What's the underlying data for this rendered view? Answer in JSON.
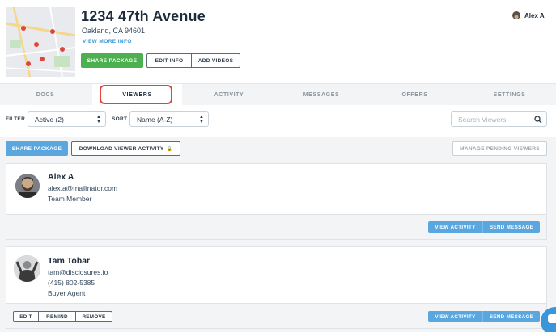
{
  "property": {
    "address": "1234 47th Avenue",
    "city": "Oakland, CA 94601",
    "view_more": "VIEW MORE INFO"
  },
  "header_actions": {
    "share_package": "SHARE PACKAGE",
    "edit_info": "EDIT INFO",
    "add_videos": "ADD VIDEOS"
  },
  "user": {
    "name": "Alex A"
  },
  "tabs": [
    {
      "label": "DOCS"
    },
    {
      "label": "VIEWERS"
    },
    {
      "label": "ACTIVITY"
    },
    {
      "label": "MESSAGES"
    },
    {
      "label": "OFFERS"
    },
    {
      "label": "SETTINGS"
    }
  ],
  "active_tab": "VIEWERS",
  "filters": {
    "filter_label": "FILTER",
    "filter_value": "Active (2)",
    "sort_label": "SORT",
    "sort_value": "Name (A-Z)",
    "search_placeholder": "Search Viewers"
  },
  "toolbar": {
    "share_package": "SHARE PACKAGE",
    "download_activity": "DOWNLOAD VIEWER ACTIVITY",
    "manage_pending": "MANAGE PENDING VIEWERS"
  },
  "viewers": [
    {
      "name": "Alex A",
      "email": "alex.a@mailinator.com",
      "role": "Team Member",
      "actions": [
        "VIEW ACTIVITY",
        "SEND MESSAGE"
      ]
    },
    {
      "name": "Tam Tobar",
      "email": "tam@disclosures.io",
      "phone": "(415) 802-5385",
      "role": "Buyer Agent",
      "edit_actions": [
        "EDIT",
        "REMIND",
        "REMOVE"
      ],
      "actions": [
        "VIEW ACTIVITY",
        "SEND MESSAGE"
      ]
    }
  ],
  "colors": {
    "green": "#4caf50",
    "blue": "#5aa7e0",
    "highlight": "#e0443a"
  }
}
